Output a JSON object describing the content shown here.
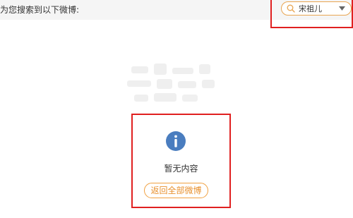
{
  "header": {
    "heading": "为您搜索到以下微博:"
  },
  "search": {
    "query": "宋祖儿",
    "icon": "search-icon",
    "dropdown_icon": "chevron-down-icon",
    "accent_color": "#e8a552"
  },
  "empty_state": {
    "icon": "info-icon",
    "icon_color": "#4a7dbf",
    "message": "暂无内容",
    "button_label": "返回全部微博",
    "button_color": "#e8912f"
  },
  "annotation": {
    "highlight_color": "#e02020"
  }
}
